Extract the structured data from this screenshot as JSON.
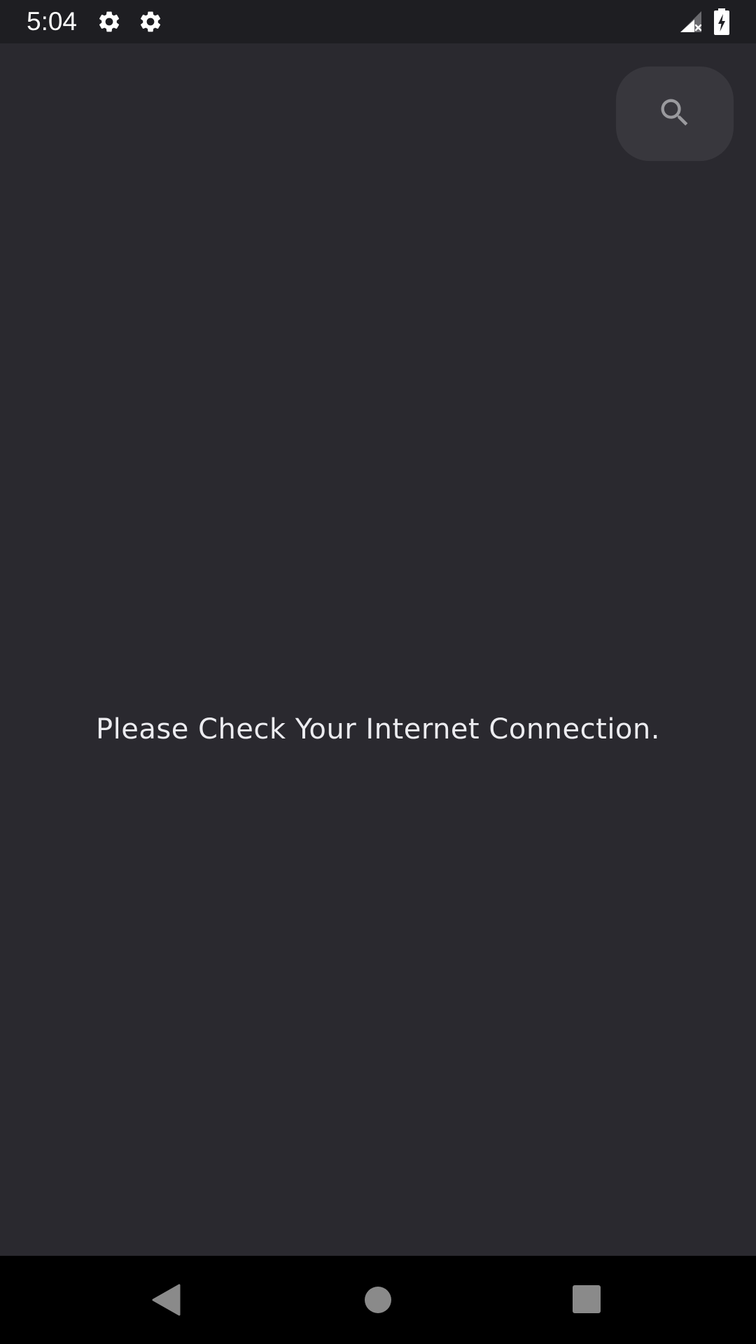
{
  "status_bar": {
    "time": "5:04",
    "icons": [
      "gear-icon",
      "gear-icon",
      "cellular-signal-no-service-icon",
      "battery-charging-icon"
    ]
  },
  "search_button": {
    "icon": "search-icon"
  },
  "main": {
    "message": "Please Check Your Internet Connection."
  },
  "navigation_bar": {
    "buttons": [
      "back-icon",
      "home-icon",
      "recents-icon"
    ]
  },
  "colors": {
    "background": "#2a292f",
    "status_bar": "#1e1e22",
    "fab": "#38373d",
    "text": "#ececf0",
    "nav_bar": "#000000",
    "nav_icons": "#8a8a8a"
  }
}
